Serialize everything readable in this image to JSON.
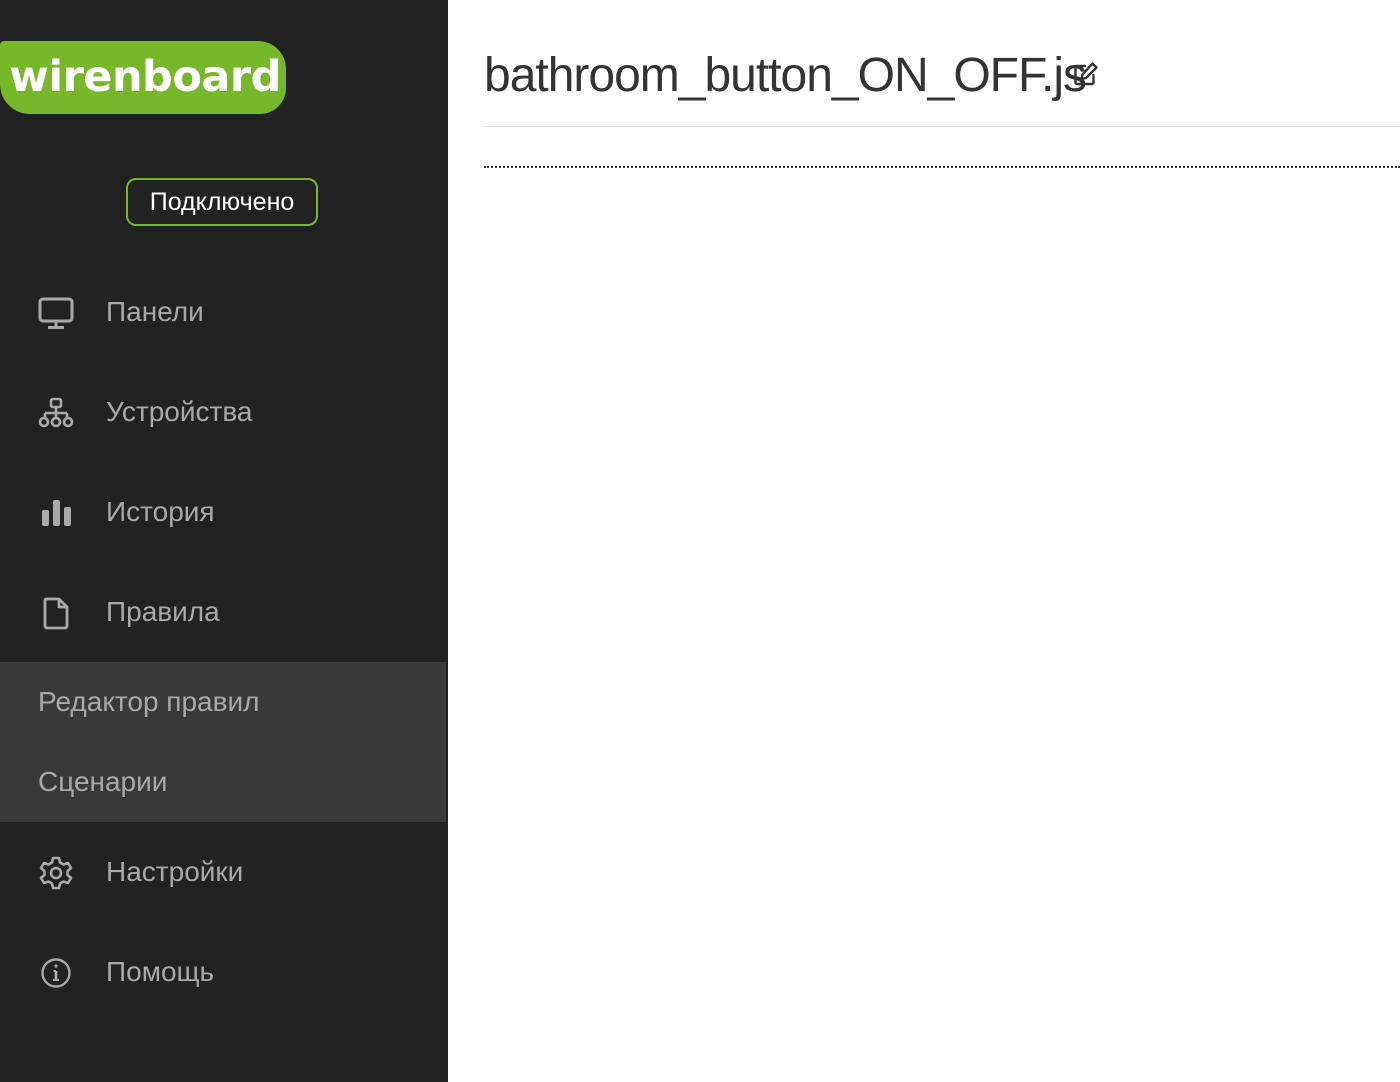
{
  "app": {
    "logo_text": "wirenboard",
    "connection_status": "Подключено"
  },
  "colors": {
    "sidebar_bg": "#222222",
    "submenu_bg": "#393939",
    "accent": "#77b82a",
    "nav_text": "#a9a9a9"
  },
  "sidebar": {
    "items": [
      {
        "label": "Панели",
        "icon": "monitor-icon"
      },
      {
        "label": "Устройства",
        "icon": "sitemap-icon"
      },
      {
        "label": "История",
        "icon": "bar-chart-icon"
      },
      {
        "label": "Правила",
        "icon": "file-icon"
      },
      {
        "label": "Настройки",
        "icon": "gear-icon"
      },
      {
        "label": "Помощь",
        "icon": "info-icon"
      }
    ],
    "submenu": [
      {
        "label": "Редактор правил"
      },
      {
        "label": "Сценарии"
      }
    ]
  },
  "main": {
    "title": "bathroom_button_ON_OFF.js",
    "edit_icon": "edit-icon"
  }
}
